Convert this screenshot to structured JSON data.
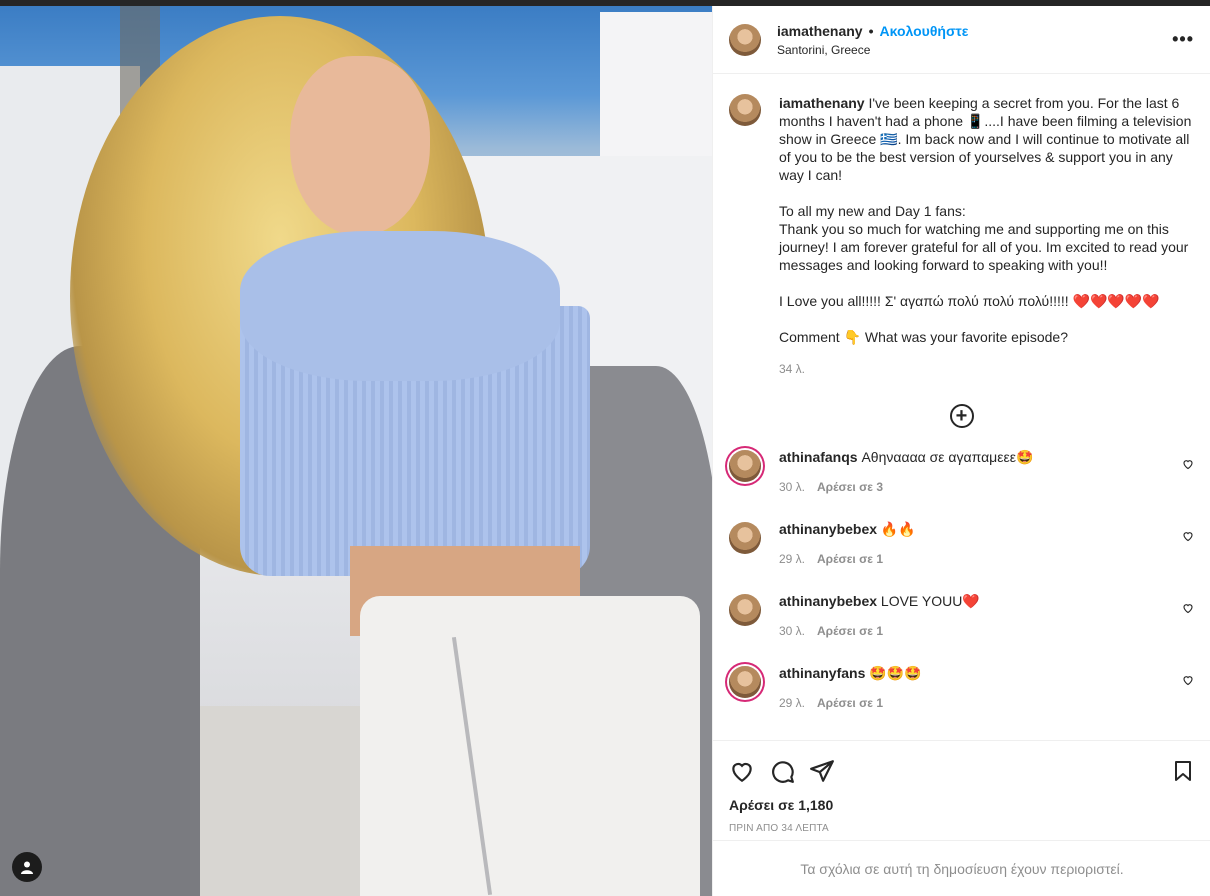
{
  "post": {
    "username": "iamathenany",
    "follow_label": "Ακολουθήστε",
    "location": "Santorini, Greece"
  },
  "caption": {
    "username": "iamathenany",
    "text": "I've been keeping a secret from you. For the last 6 months I haven't had a phone 📱....I have been filming a television show in Greece 🇬🇷. Im back now and I will continue to motivate all of you to be the best version of yourselves & support you in any way I can!\n\nTo all my new and Day 1 fans:\nThank you so much for watching me and supporting me on this journey! I am forever grateful for all of you. Im excited to read your messages and looking forward to speaking with you!!\n\nI Love you all!!!!! Σ' αγαπώ πολύ πολύ πολύ!!!!! ❤️❤️❤️❤️❤️\n\nComment 👇 What was your favorite episode?",
    "time": "34 λ."
  },
  "comments": [
    {
      "username": "athinafanqs",
      "text": "Αθηναααα σε αγαπαμεεε🤩",
      "time": "30 λ.",
      "likes": "Αρέσει σε 3"
    },
    {
      "username": "athinanybebex",
      "text": "🔥🔥",
      "time": "29 λ.",
      "likes": "Αρέσει σε 1"
    },
    {
      "username": "athinanybebex",
      "text": "LOVE YOUU❤️",
      "time": "30 λ.",
      "likes": "Αρέσει σε 1"
    },
    {
      "username": "athinanyfans",
      "text": "🤩🤩🤩",
      "time": "29 λ.",
      "likes": "Αρέσει σε 1"
    }
  ],
  "footer": {
    "likes": "Αρέσει σε 1,180",
    "time_ago": "ΠΡΙΝ ΑΠΟ 34 ΛΕΠΤΑ",
    "comments_restricted": "Τα σχόλια σε αυτή τη δημοσίευση έχουν περιοριστεί."
  },
  "icons": {
    "more": "more-options-icon",
    "load_more": "plus-circle-icon",
    "like": "heart-icon",
    "comment": "comment-bubble-icon",
    "share": "paper-plane-icon",
    "save": "bookmark-icon",
    "user": "user-tag-icon"
  }
}
